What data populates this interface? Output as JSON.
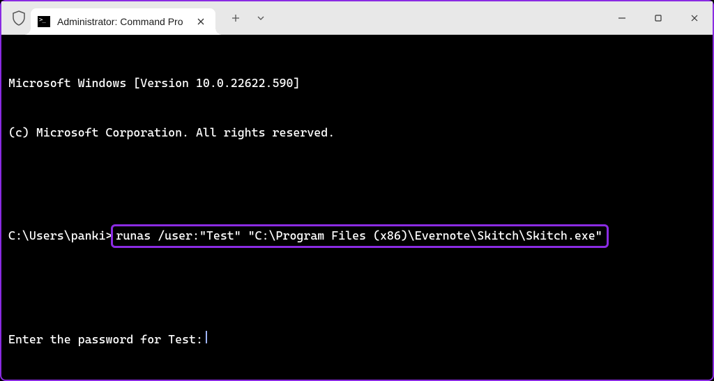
{
  "tab": {
    "title": "Administrator: Command Pro"
  },
  "terminal": {
    "line1": "Microsoft Windows [Version 10.0.22622.590]",
    "line2": "(c) Microsoft Corporation. All rights reserved.",
    "prompt_path": "C:\\Users\\panki>",
    "command": "runas /user:\"Test\" \"C:\\Program Files (x86)\\Evernote\\Skitch\\Skitch.exe\"",
    "password_prompt": "Enter the password for Test:"
  },
  "highlight_color": "#8a2be2"
}
